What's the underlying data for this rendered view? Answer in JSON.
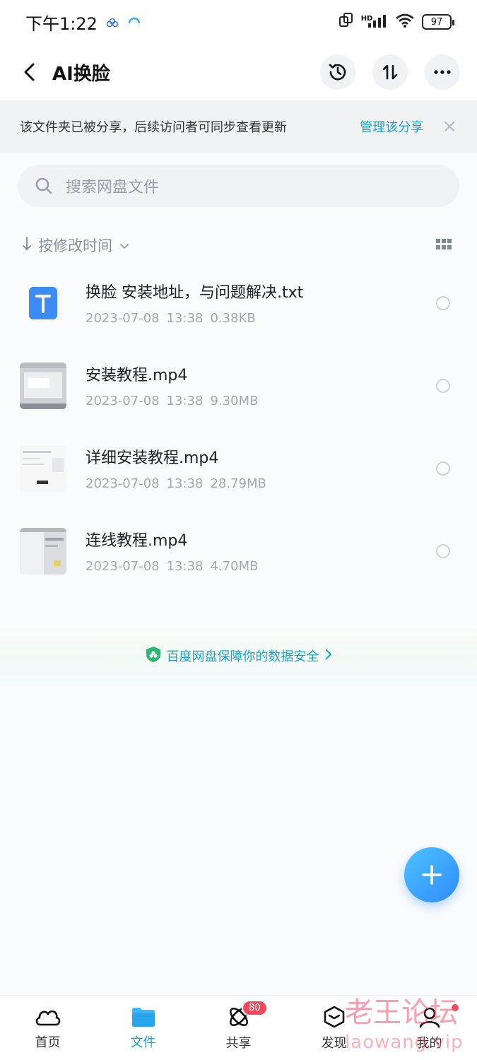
{
  "status_bar": {
    "time": "下午1:22",
    "battery": "97",
    "hd": "HD"
  },
  "header": {
    "title": "AI换脸"
  },
  "banner": {
    "text": "该文件夹已被分享，后续访问者可同步查看更新",
    "manage_label": "管理该分享"
  },
  "search": {
    "placeholder": "搜索网盘文件"
  },
  "sort": {
    "label": "按修改时间"
  },
  "files": [
    {
      "name": "换脸  安装地址，与问题解决.txt",
      "date": "2023-07-08",
      "time": "13:38",
      "size": "0.38KB",
      "type": "txt"
    },
    {
      "name": "安装教程.mp4",
      "date": "2023-07-08",
      "time": "13:38",
      "size": "9.30MB",
      "type": "video"
    },
    {
      "name": "详细安装教程.mp4",
      "date": "2023-07-08",
      "time": "13:38",
      "size": "28.79MB",
      "type": "video"
    },
    {
      "name": "连线教程.mp4",
      "date": "2023-07-08",
      "time": "13:38",
      "size": "4.70MB",
      "type": "video"
    }
  ],
  "security": {
    "text": "百度网盘保障你的数据安全"
  },
  "bottom_nav": {
    "items": [
      {
        "label": "首页"
      },
      {
        "label": "文件"
      },
      {
        "label": "共享",
        "badge": "80"
      },
      {
        "label": "发现"
      },
      {
        "label": "我的"
      }
    ]
  },
  "watermark": {
    "line1": "老王论坛",
    "line2": "laowang.vip"
  },
  "colors": {
    "accent": "#1aa5c9",
    "fab": "#2e8bff",
    "badge": "#f04a5d"
  }
}
